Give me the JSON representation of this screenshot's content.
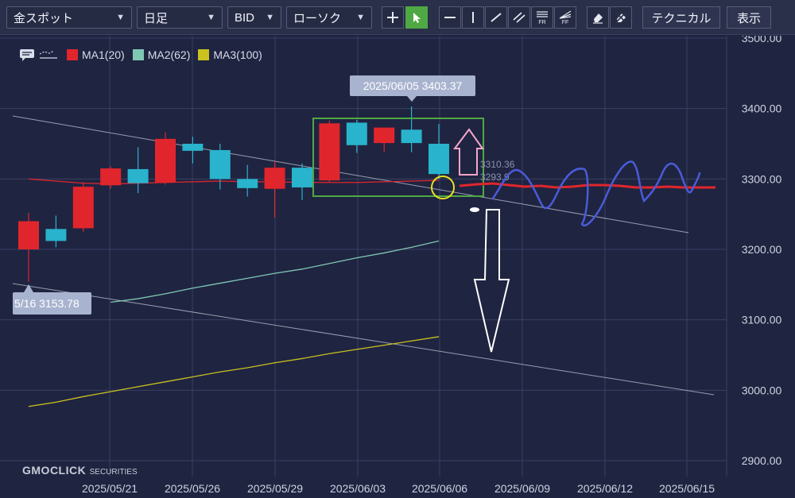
{
  "toolbar": {
    "symbol": "金スポット",
    "timeframe": "日足",
    "price_type": "BID",
    "chart_style": "ローソク",
    "technical_label": "テクニカル",
    "display_label": "表示",
    "tools": [
      "crosshair-icon",
      "pointer-icon",
      "horizontal-line-icon",
      "vertical-line-icon",
      "trend-line-icon",
      "parallel-lines-icon",
      "fibonacci-retracement-icon",
      "fibonacci-fan-icon",
      "erase-icon",
      "erase-all-icon"
    ],
    "fr_label": "FR",
    "ff_label": "FF"
  },
  "legend": [
    {
      "name": "MA1(20)",
      "color": "#e0262c"
    },
    {
      "name": "MA2(62)",
      "color": "#7fc8b4"
    },
    {
      "name": "MA3(100)",
      "color": "#c9c21f"
    }
  ],
  "tooltips": {
    "high": "2025/06/05 3403.37",
    "low": "5/16 3153.78"
  },
  "overlay_values": [
    "3310.36",
    "3293.9"
  ],
  "logo": {
    "main": "GMOCLICK",
    "sub": "SECURITIES"
  },
  "colors": {
    "up": "#e0262c",
    "down": "#29b3cc",
    "grid": "#3a4062",
    "box": "#4ea944",
    "freehand": "#4a5bd8",
    "forecast_red": "#e0262c",
    "circle": "#e8e21f",
    "arrow_up": "#f3a6c8",
    "arrow_down": "#ffffff",
    "trendline": "#b8bccb"
  },
  "chart_data": {
    "type": "candlestick",
    "y_ticks": [
      "3500.00",
      "3400.00",
      "3300.00",
      "3200.00",
      "3100.00",
      "3000.00",
      "2900.00"
    ],
    "ylim": [
      2900,
      3500
    ],
    "x_ticks": [
      "2025/05/21",
      "2025/05/26",
      "2025/05/29",
      "2025/06/03",
      "2025/06/06",
      "2025/06/09",
      "2025/06/12",
      "2025/06/15"
    ],
    "candles": [
      {
        "o": 3200,
        "h": 3252,
        "l": 3154,
        "c": 3240
      },
      {
        "o": 3229,
        "h": 3248,
        "l": 3203,
        "c": 3212
      },
      {
        "o": 3230,
        "h": 3295,
        "l": 3225,
        "c": 3289
      },
      {
        "o": 3291,
        "h": 3318,
        "l": 3286,
        "c": 3315
      },
      {
        "o": 3314,
        "h": 3345,
        "l": 3280,
        "c": 3294
      },
      {
        "o": 3295,
        "h": 3366,
        "l": 3292,
        "c": 3357
      },
      {
        "o": 3350,
        "h": 3360,
        "l": 3322,
        "c": 3340
      },
      {
        "o": 3341,
        "h": 3350,
        "l": 3285,
        "c": 3300
      },
      {
        "o": 3300,
        "h": 3320,
        "l": 3275,
        "c": 3287
      },
      {
        "o": 3286,
        "h": 3325,
        "l": 3245,
        "c": 3316
      },
      {
        "o": 3316,
        "h": 3322,
        "l": 3270,
        "c": 3288
      },
      {
        "o": 3298,
        "h": 3383,
        "l": 3296,
        "c": 3379
      },
      {
        "o": 3380,
        "h": 3384,
        "l": 3337,
        "c": 3348
      },
      {
        "o": 3351,
        "h": 3368,
        "l": 3338,
        "c": 3373
      },
      {
        "o": 3370,
        "h": 3403,
        "l": 3338,
        "c": 3351
      },
      {
        "o": 3350,
        "h": 3378,
        "l": 3300,
        "c": 3307
      }
    ],
    "ma1": [
      3300,
      3297,
      3294,
      3293,
      3294,
      3295,
      3296,
      3297,
      3296,
      3296,
      3295,
      3295,
      3295,
      3296,
      3297,
      3298
    ],
    "ma2": [
      null,
      null,
      null,
      3125,
      3130,
      3137,
      3145,
      3152,
      3159,
      3166,
      3172,
      3180,
      3188,
      3195,
      3203,
      3212
    ],
    "ma3": [
      2977,
      2983,
      2991,
      2998,
      3005,
      3012,
      3019,
      3026,
      3032,
      3039,
      3045,
      3052,
      3058,
      3064,
      3070,
      3076
    ]
  }
}
